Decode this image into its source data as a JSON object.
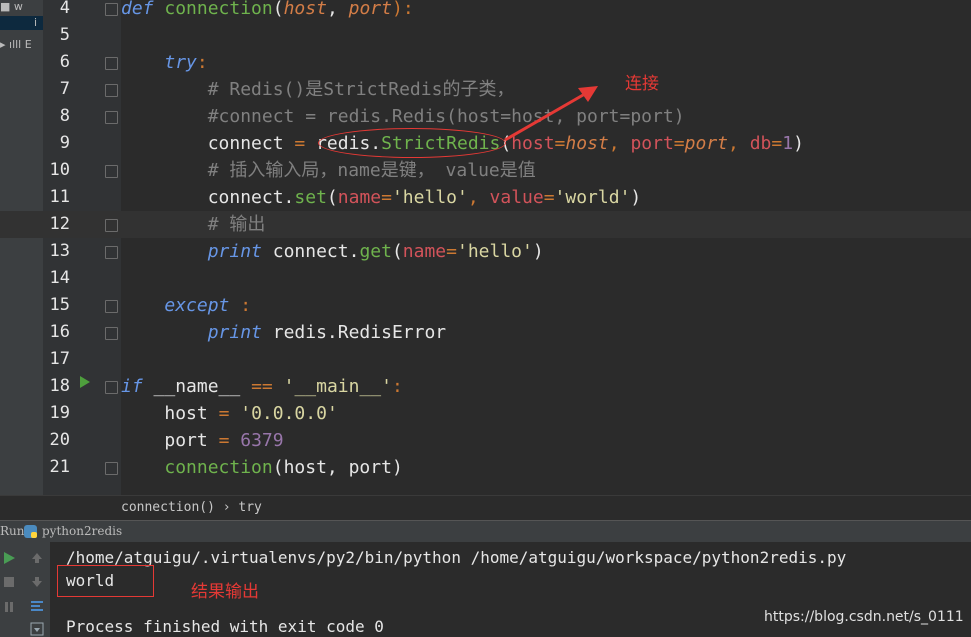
{
  "left_strip": {
    "row1": "■ w",
    "row2": "ⅰ",
    "row3": "▸ ılll E"
  },
  "lines": [
    {
      "n": "4"
    },
    {
      "n": "5"
    },
    {
      "n": "6"
    },
    {
      "n": "7"
    },
    {
      "n": "8"
    },
    {
      "n": "9"
    },
    {
      "n": "10"
    },
    {
      "n": "11"
    },
    {
      "n": "12"
    },
    {
      "n": "13"
    },
    {
      "n": "14"
    },
    {
      "n": "15"
    },
    {
      "n": "16"
    },
    {
      "n": "17"
    },
    {
      "n": "18"
    },
    {
      "n": "19"
    },
    {
      "n": "20"
    },
    {
      "n": "21"
    }
  ],
  "code": {
    "l4": {
      "def": "def",
      "name": "connection",
      "p1": "host",
      "p2": "port"
    },
    "l6": {
      "try": "try"
    },
    "l7": {
      "comment": "# Redis()是StrictRedis的子类，"
    },
    "l8": {
      "comment": "#connect = redis.Redis(host=host, port=port)"
    },
    "l9": {
      "var": "connect",
      "mod": "redis.",
      "cls": "StrictRedis",
      "k1": "host",
      "v1": "host",
      "k2": "port",
      "v2": "port",
      "k3": "db",
      "v3": "1"
    },
    "l10": {
      "comment": "# 插入输入局，name是键， value是值"
    },
    "l11": {
      "obj": "connect.",
      "fn": "set",
      "k1": "name",
      "v1": "'hello'",
      "k2": "value",
      "v2": "'world'"
    },
    "l12": {
      "comment": "# 输出"
    },
    "l13": {
      "print": "print",
      "obj": "connect.",
      "fn": "get",
      "k1": "name",
      "v1": "'hello'"
    },
    "l15": {
      "except": "except"
    },
    "l16": {
      "print": "print",
      "rest": "redis.RedisError"
    },
    "l18": {
      "if": "if",
      "name": "__name__",
      "op": "==",
      "str": "'__main__'"
    },
    "l19": {
      "var": "host",
      "str": "'0.0.0.0'"
    },
    "l20": {
      "var": "port",
      "num": "6379"
    },
    "l21": {
      "fn": "connection",
      "args": "(host, port)"
    }
  },
  "breadcrumb": {
    "text": "connection() › try"
  },
  "run": {
    "label": "Run",
    "file": "python2redis"
  },
  "console": {
    "line1": "/home/atguigu/.virtualenvs/py2/bin/python /home/atguigu/workspace/python2redis.py",
    "line2": "world",
    "line3": "Process finished with exit code 0"
  },
  "annotations": {
    "connect": "连接",
    "result": "结果输出"
  },
  "watermark": "https://blog.csdn.net/s_0111",
  "colors": {
    "accent_red": "#e53935",
    "bg": "#2b2b2b"
  }
}
